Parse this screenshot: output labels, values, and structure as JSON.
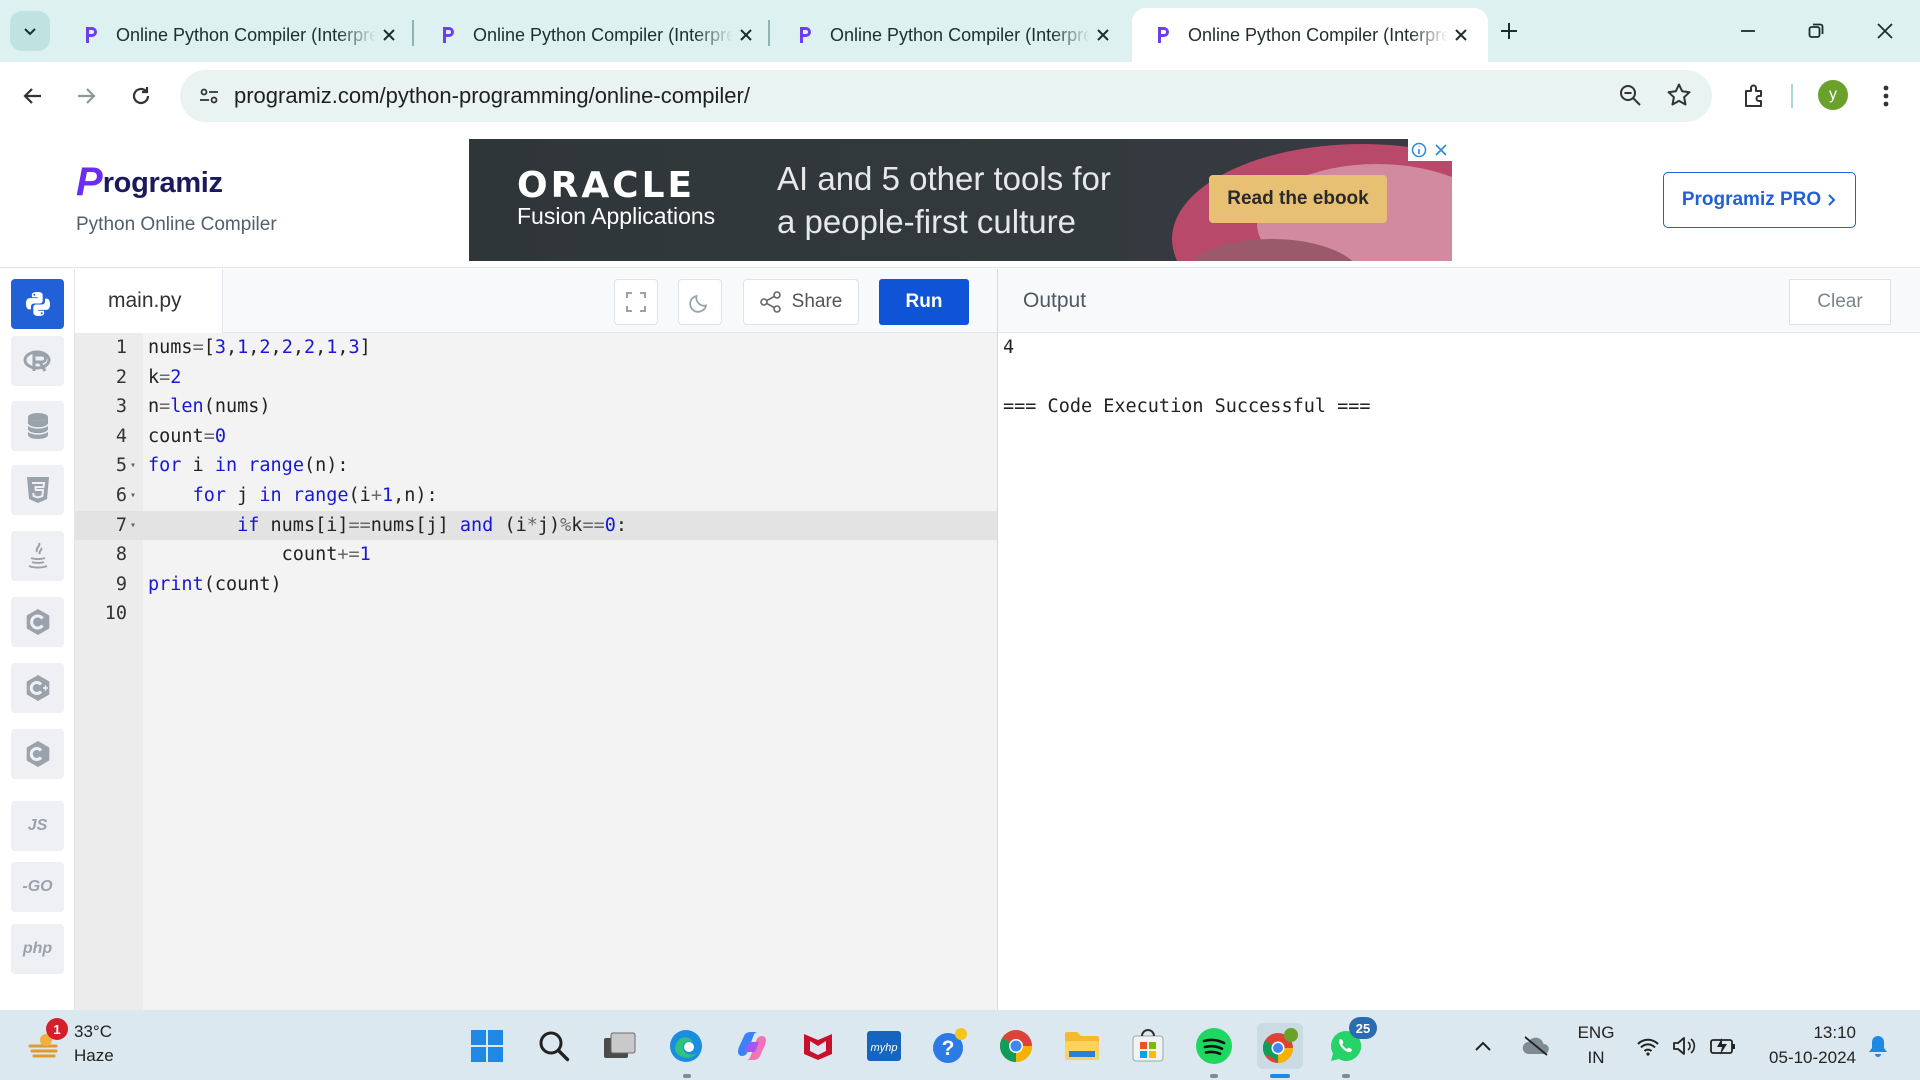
{
  "browser": {
    "tabs": [
      {
        "title": "Online Python Compiler (Interpreter)",
        "active": false
      },
      {
        "title": "Online Python Compiler (Interpreter)",
        "active": false
      },
      {
        "title": "Online Python Compiler (Interpreter)",
        "active": false
      },
      {
        "title": "Online Python Compiler (Interpreter)",
        "active": true
      }
    ],
    "url": "programiz.com/python-programming/online-compiler/",
    "profile_initial": "y"
  },
  "site": {
    "logo_text": "rogramiz",
    "logo_letter": "P",
    "subtitle": "Python Online Compiler",
    "pro_button": "Programiz PRO",
    "ad": {
      "brand": "ORACLE",
      "product": "Fusion Applications",
      "tagline_1": "AI and 5 other tools for",
      "tagline_2": "a people-first culture",
      "cta": "Read the ebook"
    },
    "sidebar_labels": {
      "js": "JS",
      "go": "-GO",
      "php": "php"
    }
  },
  "editor": {
    "filename": "main.py",
    "share_label": "Share",
    "run_label": "Run",
    "line_numbers": [
      "1",
      "2",
      "3",
      "4",
      "5",
      "6",
      "7",
      "8",
      "9",
      "10"
    ],
    "lines": [
      "nums=[3,1,2,2,2,1,3]",
      "k=2",
      "n=len(nums)",
      "count=0",
      "for i in range(n):",
      "    for j in range(i+1,n):",
      "        if nums[i]==nums[j] and (i*j)%k==0:",
      "            count+=1",
      "print(count)",
      ""
    ]
  },
  "output": {
    "label": "Output",
    "clear_label": "Clear",
    "lines": [
      "4",
      "",
      "=== Code Execution Successful ==="
    ]
  },
  "taskbar": {
    "weather_temp": "33°C",
    "weather_desc": "Haze",
    "weather_badge": "1",
    "whatsapp_badge": "25",
    "lang_1": "ENG",
    "lang_2": "IN",
    "time": "13:10",
    "date": "05-10-2024"
  },
  "colors": {
    "run": "#0f54d6",
    "pro": "#2160d6",
    "tab_bar": "#dcf1f0",
    "taskbar": "#dce8ef"
  }
}
